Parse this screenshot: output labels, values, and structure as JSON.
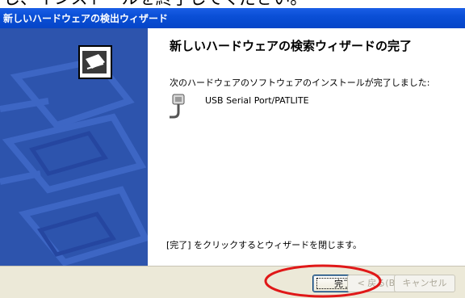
{
  "caption_fragment": "し、インストールを終了してください。",
  "window": {
    "title": "新しいハードウェアの検出ウィザード"
  },
  "content": {
    "heading": "新しいハードウェアの検索ウィザードの完了",
    "intro": "次のハードウェアのソフトウェアのインストールが完了しました:",
    "device_name": "USB Serial Port/PATLITE",
    "device_icon": "serial-port-connector-icon",
    "finish_hint": "[完了] をクリックするとウィザードを閉じます。"
  },
  "buttons": {
    "back": "< 戻る(B)",
    "finish": "完了",
    "cancel": "キャンセル"
  },
  "annotation": {
    "color": "#e01818",
    "target": "finish-button"
  },
  "colors": {
    "titlebar": "#0a4fd6",
    "sidebar": "#2d54ad",
    "button_face": "#ece9d8"
  }
}
